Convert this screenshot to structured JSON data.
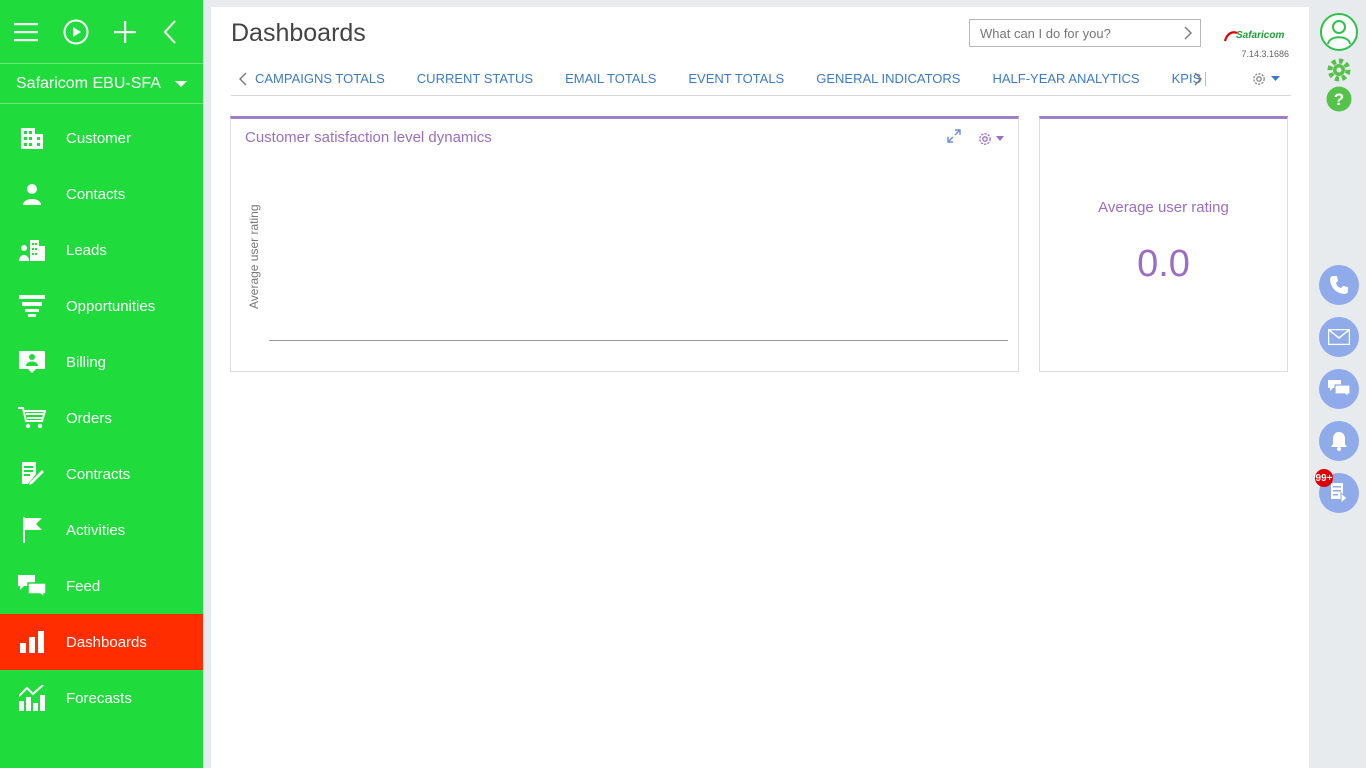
{
  "sidebar": {
    "workspace": "Safaricom EBU-SFA",
    "items": [
      {
        "label": "Customer",
        "icon": "building-icon"
      },
      {
        "label": "Contacts",
        "icon": "person-icon"
      },
      {
        "label": "Leads",
        "icon": "leads-icon"
      },
      {
        "label": "Opportunities",
        "icon": "funnel-icon"
      },
      {
        "label": "Billing",
        "icon": "billing-icon"
      },
      {
        "label": "Orders",
        "icon": "cart-icon"
      },
      {
        "label": "Contracts",
        "icon": "contract-icon"
      },
      {
        "label": "Activities",
        "icon": "flag-icon"
      },
      {
        "label": "Feed",
        "icon": "feed-icon"
      },
      {
        "label": "Dashboards",
        "icon": "bar-chart-icon",
        "active": true
      },
      {
        "label": "Forecasts",
        "icon": "forecast-icon"
      }
    ],
    "colors": {
      "background": "#1fdc3c",
      "active": "#ff2d00"
    }
  },
  "header": {
    "title": "Dashboards",
    "search_placeholder": "What can I do for you?",
    "logo_text": "Safaricom",
    "version": "7.14.3.1686"
  },
  "tabs": [
    "CAMPAIGNS TOTALS",
    "CURRENT STATUS",
    "EMAIL TOTALS",
    "EVENT TOTALS",
    "GENERAL INDICATORS",
    "HALF-YEAR ANALYTICS",
    "KPIS"
  ],
  "widgets": {
    "chart": {
      "title": "Customer satisfaction level dynamics",
      "ylabel": "Average user rating"
    },
    "metric": {
      "label": "Average user rating",
      "value": "0.0"
    }
  },
  "rail": {
    "badge": "99+"
  },
  "accent": "#a07fc9"
}
